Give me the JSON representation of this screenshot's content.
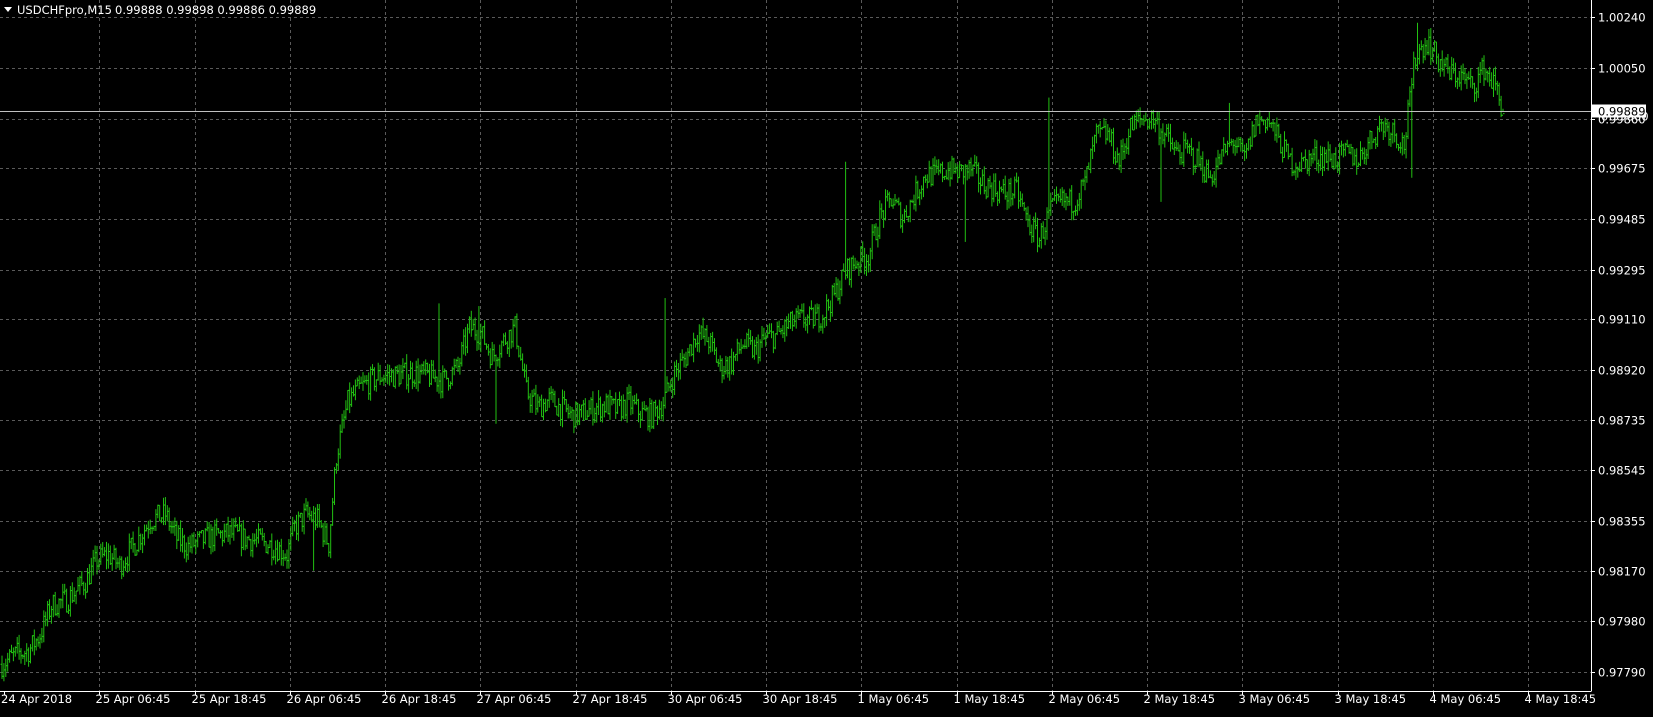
{
  "header": {
    "dropdown_icon": "triangle-down-icon",
    "symbol": "USDCHFpro,M15",
    "ohlc": "0.99888 0.99898 0.99886 0.99889"
  },
  "colors": {
    "background": "#000000",
    "grid": "#5a5a5a",
    "frame": "#ffffff",
    "text": "#ffffff",
    "bar": "#22c012",
    "bid_line": "#c0c0c0",
    "price_tag_bg": "#ffffff",
    "price_tag_text": "#000000"
  },
  "current_price": {
    "value": 0.99889,
    "label": "0.99889",
    "underlying_label": "0.99860"
  },
  "chart_data": {
    "type": "bar",
    "title": "USDCHFpro,M15",
    "timeframe": "M15",
    "grid": true,
    "price_axis": {
      "position": "right",
      "ylim": [
        0.9772,
        1.00305
      ],
      "ticks": [
        1.0024,
        1.0005,
        0.9986,
        0.99675,
        0.99485,
        0.99295,
        0.9911,
        0.9892,
        0.98735,
        0.98545,
        0.98355,
        0.9817,
        0.9798,
        0.9779
      ],
      "tick_labels": [
        "1.00240",
        "1.00050",
        "0.99860",
        "0.99675",
        "0.99485",
        "0.99295",
        "0.99110",
        "0.98920",
        "0.98735",
        "0.98545",
        "0.98355",
        "0.98170",
        "0.97980",
        "0.97790"
      ]
    },
    "time_axis": {
      "tick_labels": [
        "24 Apr 2018",
        "25 Apr 06:45",
        "25 Apr 18:45",
        "26 Apr 06:45",
        "26 Apr 18:45",
        "27 Apr 06:45",
        "27 Apr 18:45",
        "30 Apr 06:45",
        "30 Apr 18:45",
        "1 May 06:45",
        "1 May 18:45",
        "2 May 06:45",
        "2 May 18:45",
        "3 May 06:45",
        "3 May 18:45",
        "4 May 06:45",
        "4 May 18:45"
      ],
      "bars_per_label": 48
    },
    "series": [
      {
        "price_path": [
          [
            0,
            0.9782
          ],
          [
            8,
            0.9786
          ],
          [
            14,
            0.9787
          ],
          [
            20,
            0.9793
          ],
          [
            26,
            0.9804
          ],
          [
            34,
            0.9806
          ],
          [
            44,
            0.9813
          ],
          [
            50,
            0.9821
          ],
          [
            56,
            0.9823
          ],
          [
            62,
            0.9819
          ],
          [
            70,
            0.9827
          ],
          [
            78,
            0.9836
          ],
          [
            86,
            0.9838
          ],
          [
            92,
            0.9829
          ],
          [
            98,
            0.9826
          ],
          [
            104,
            0.9828
          ],
          [
            112,
            0.983
          ],
          [
            120,
            0.9831
          ],
          [
            128,
            0.9829
          ],
          [
            136,
            0.9828
          ],
          [
            144,
            0.9826
          ],
          [
            150,
            0.9823
          ],
          [
            154,
            0.9833
          ],
          [
            160,
            0.9838
          ],
          [
            166,
            0.9836
          ],
          [
            172,
            0.9827
          ],
          [
            176,
            0.986
          ],
          [
            182,
            0.988
          ],
          [
            188,
            0.9885
          ],
          [
            194,
            0.9888
          ],
          [
            200,
            0.989
          ],
          [
            208,
            0.989
          ],
          [
            216,
            0.9891
          ],
          [
            224,
            0.989
          ],
          [
            232,
            0.9888
          ],
          [
            240,
            0.9893
          ],
          [
            246,
            0.9908
          ],
          [
            252,
            0.9906
          ],
          [
            258,
            0.9897
          ],
          [
            264,
            0.9903
          ],
          [
            270,
            0.9908
          ],
          [
            276,
            0.9884
          ],
          [
            282,
            0.9878
          ],
          [
            288,
            0.9881
          ],
          [
            294,
            0.9878
          ],
          [
            300,
            0.9875
          ],
          [
            306,
            0.9876
          ],
          [
            312,
            0.9878
          ],
          [
            318,
            0.9879
          ],
          [
            324,
            0.9877
          ],
          [
            330,
            0.988
          ],
          [
            336,
            0.9876
          ],
          [
            342,
            0.9875
          ],
          [
            348,
            0.988
          ],
          [
            354,
            0.9891
          ],
          [
            360,
            0.9897
          ],
          [
            366,
            0.9906
          ],
          [
            372,
            0.9903
          ],
          [
            378,
            0.9893
          ],
          [
            384,
            0.9895
          ],
          [
            390,
            0.9902
          ],
          [
            396,
            0.9899
          ],
          [
            402,
            0.9904
          ],
          [
            408,
            0.9905
          ],
          [
            414,
            0.9909
          ],
          [
            420,
            0.9911
          ],
          [
            426,
            0.9911
          ],
          [
            432,
            0.9913
          ],
          [
            438,
            0.992
          ],
          [
            444,
            0.9929
          ],
          [
            450,
            0.9933
          ],
          [
            456,
            0.9935
          ],
          [
            462,
            0.9949
          ],
          [
            468,
            0.9956
          ],
          [
            474,
            0.9949
          ],
          [
            480,
            0.9957
          ],
          [
            486,
            0.9965
          ],
          [
            492,
            0.9965
          ],
          [
            498,
            0.9967
          ],
          [
            504,
            0.9966
          ],
          [
            510,
            0.9967
          ],
          [
            516,
            0.9962
          ],
          [
            522,
            0.996
          ],
          [
            528,
            0.9958
          ],
          [
            534,
            0.9959
          ],
          [
            540,
            0.9947
          ],
          [
            546,
            0.9941
          ],
          [
            552,
            0.9952
          ],
          [
            558,
            0.9955
          ],
          [
            564,
            0.9955
          ],
          [
            570,
            0.9962
          ],
          [
            576,
            0.998
          ],
          [
            582,
            0.998
          ],
          [
            588,
            0.997
          ],
          [
            594,
            0.9983
          ],
          [
            600,
            0.9986
          ],
          [
            606,
            0.9986
          ],
          [
            612,
            0.998
          ],
          [
            618,
            0.9973
          ],
          [
            624,
            0.9974
          ],
          [
            630,
            0.997
          ],
          [
            636,
            0.9964
          ],
          [
            642,
            0.9972
          ],
          [
            648,
            0.9978
          ],
          [
            654,
            0.9971
          ],
          [
            660,
            0.9985
          ],
          [
            666,
            0.9986
          ],
          [
            672,
            0.9978
          ],
          [
            678,
            0.997
          ],
          [
            684,
            0.9969
          ],
          [
            690,
            0.9972
          ],
          [
            696,
            0.9972
          ],
          [
            702,
            0.9971
          ],
          [
            708,
            0.9973
          ],
          [
            714,
            0.9971
          ],
          [
            720,
            0.9978
          ],
          [
            726,
            0.9984
          ],
          [
            732,
            0.9982
          ],
          [
            738,
            0.9976
          ],
          [
            744,
            1.001
          ],
          [
            750,
            1.0015
          ],
          [
            756,
            1.0008
          ],
          [
            762,
            1.0003
          ],
          [
            768,
            1.0002
          ],
          [
            774,
            0.9998
          ],
          [
            780,
            1.0005
          ],
          [
            786,
            0.9998
          ],
          [
            790,
            0.99889
          ]
        ],
        "spikes": [
          {
            "bar": 150,
            "low": 0.9818
          },
          {
            "bar": 164,
            "low": 0.9817
          },
          {
            "bar": 230,
            "high": 0.9917
          },
          {
            "bar": 251,
            "high": 0.9916
          },
          {
            "bar": 260,
            "low": 0.9872
          },
          {
            "bar": 306,
            "low": 0.9873
          },
          {
            "bar": 349,
            "high": 0.9919
          },
          {
            "bar": 444,
            "high": 0.997
          },
          {
            "bar": 507,
            "low": 0.994
          },
          {
            "bar": 546,
            "low": 0.9947
          },
          {
            "bar": 551,
            "high": 0.9994
          },
          {
            "bar": 610,
            "low": 0.9955
          },
          {
            "bar": 646,
            "high": 0.9992
          },
          {
            "bar": 742,
            "low": 0.9964
          },
          {
            "bar": 745,
            "high": 1.0022
          },
          {
            "bar": 752,
            "high": 1.002
          }
        ]
      }
    ]
  }
}
